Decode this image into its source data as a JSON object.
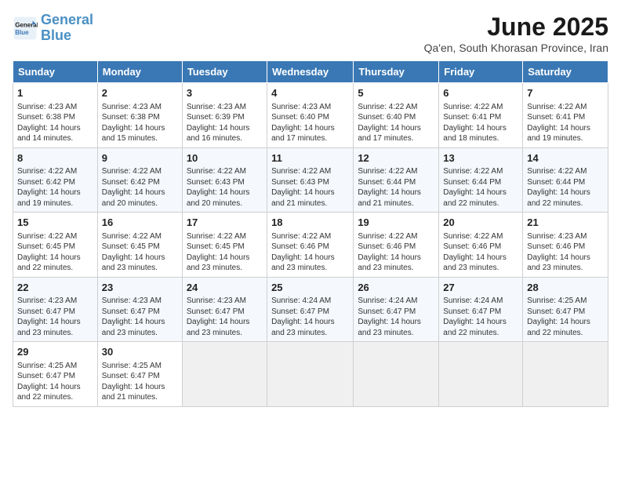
{
  "header": {
    "logo_line1": "General",
    "logo_line2": "Blue",
    "month_title": "June 2025",
    "subtitle": "Qa'en, South Khorasan Province, Iran"
  },
  "weekdays": [
    "Sunday",
    "Monday",
    "Tuesday",
    "Wednesday",
    "Thursday",
    "Friday",
    "Saturday"
  ],
  "weeks": [
    [
      {
        "day": "1",
        "info": "Sunrise: 4:23 AM\nSunset: 6:38 PM\nDaylight: 14 hours\nand 14 minutes."
      },
      {
        "day": "2",
        "info": "Sunrise: 4:23 AM\nSunset: 6:38 PM\nDaylight: 14 hours\nand 15 minutes."
      },
      {
        "day": "3",
        "info": "Sunrise: 4:23 AM\nSunset: 6:39 PM\nDaylight: 14 hours\nand 16 minutes."
      },
      {
        "day": "4",
        "info": "Sunrise: 4:23 AM\nSunset: 6:40 PM\nDaylight: 14 hours\nand 17 minutes."
      },
      {
        "day": "5",
        "info": "Sunrise: 4:22 AM\nSunset: 6:40 PM\nDaylight: 14 hours\nand 17 minutes."
      },
      {
        "day": "6",
        "info": "Sunrise: 4:22 AM\nSunset: 6:41 PM\nDaylight: 14 hours\nand 18 minutes."
      },
      {
        "day": "7",
        "info": "Sunrise: 4:22 AM\nSunset: 6:41 PM\nDaylight: 14 hours\nand 19 minutes."
      }
    ],
    [
      {
        "day": "8",
        "info": "Sunrise: 4:22 AM\nSunset: 6:42 PM\nDaylight: 14 hours\nand 19 minutes."
      },
      {
        "day": "9",
        "info": "Sunrise: 4:22 AM\nSunset: 6:42 PM\nDaylight: 14 hours\nand 20 minutes."
      },
      {
        "day": "10",
        "info": "Sunrise: 4:22 AM\nSunset: 6:43 PM\nDaylight: 14 hours\nand 20 minutes."
      },
      {
        "day": "11",
        "info": "Sunrise: 4:22 AM\nSunset: 6:43 PM\nDaylight: 14 hours\nand 21 minutes."
      },
      {
        "day": "12",
        "info": "Sunrise: 4:22 AM\nSunset: 6:44 PM\nDaylight: 14 hours\nand 21 minutes."
      },
      {
        "day": "13",
        "info": "Sunrise: 4:22 AM\nSunset: 6:44 PM\nDaylight: 14 hours\nand 22 minutes."
      },
      {
        "day": "14",
        "info": "Sunrise: 4:22 AM\nSunset: 6:44 PM\nDaylight: 14 hours\nand 22 minutes."
      }
    ],
    [
      {
        "day": "15",
        "info": "Sunrise: 4:22 AM\nSunset: 6:45 PM\nDaylight: 14 hours\nand 22 minutes."
      },
      {
        "day": "16",
        "info": "Sunrise: 4:22 AM\nSunset: 6:45 PM\nDaylight: 14 hours\nand 23 minutes."
      },
      {
        "day": "17",
        "info": "Sunrise: 4:22 AM\nSunset: 6:45 PM\nDaylight: 14 hours\nand 23 minutes."
      },
      {
        "day": "18",
        "info": "Sunrise: 4:22 AM\nSunset: 6:46 PM\nDaylight: 14 hours\nand 23 minutes."
      },
      {
        "day": "19",
        "info": "Sunrise: 4:22 AM\nSunset: 6:46 PM\nDaylight: 14 hours\nand 23 minutes."
      },
      {
        "day": "20",
        "info": "Sunrise: 4:22 AM\nSunset: 6:46 PM\nDaylight: 14 hours\nand 23 minutes."
      },
      {
        "day": "21",
        "info": "Sunrise: 4:23 AM\nSunset: 6:46 PM\nDaylight: 14 hours\nand 23 minutes."
      }
    ],
    [
      {
        "day": "22",
        "info": "Sunrise: 4:23 AM\nSunset: 6:47 PM\nDaylight: 14 hours\nand 23 minutes."
      },
      {
        "day": "23",
        "info": "Sunrise: 4:23 AM\nSunset: 6:47 PM\nDaylight: 14 hours\nand 23 minutes."
      },
      {
        "day": "24",
        "info": "Sunrise: 4:23 AM\nSunset: 6:47 PM\nDaylight: 14 hours\nand 23 minutes."
      },
      {
        "day": "25",
        "info": "Sunrise: 4:24 AM\nSunset: 6:47 PM\nDaylight: 14 hours\nand 23 minutes."
      },
      {
        "day": "26",
        "info": "Sunrise: 4:24 AM\nSunset: 6:47 PM\nDaylight: 14 hours\nand 23 minutes."
      },
      {
        "day": "27",
        "info": "Sunrise: 4:24 AM\nSunset: 6:47 PM\nDaylight: 14 hours\nand 22 minutes."
      },
      {
        "day": "28",
        "info": "Sunrise: 4:25 AM\nSunset: 6:47 PM\nDaylight: 14 hours\nand 22 minutes."
      }
    ],
    [
      {
        "day": "29",
        "info": "Sunrise: 4:25 AM\nSunset: 6:47 PM\nDaylight: 14 hours\nand 22 minutes."
      },
      {
        "day": "30",
        "info": "Sunrise: 4:25 AM\nSunset: 6:47 PM\nDaylight: 14 hours\nand 21 minutes."
      },
      {
        "day": "",
        "info": ""
      },
      {
        "day": "",
        "info": ""
      },
      {
        "day": "",
        "info": ""
      },
      {
        "day": "",
        "info": ""
      },
      {
        "day": "",
        "info": ""
      }
    ]
  ]
}
